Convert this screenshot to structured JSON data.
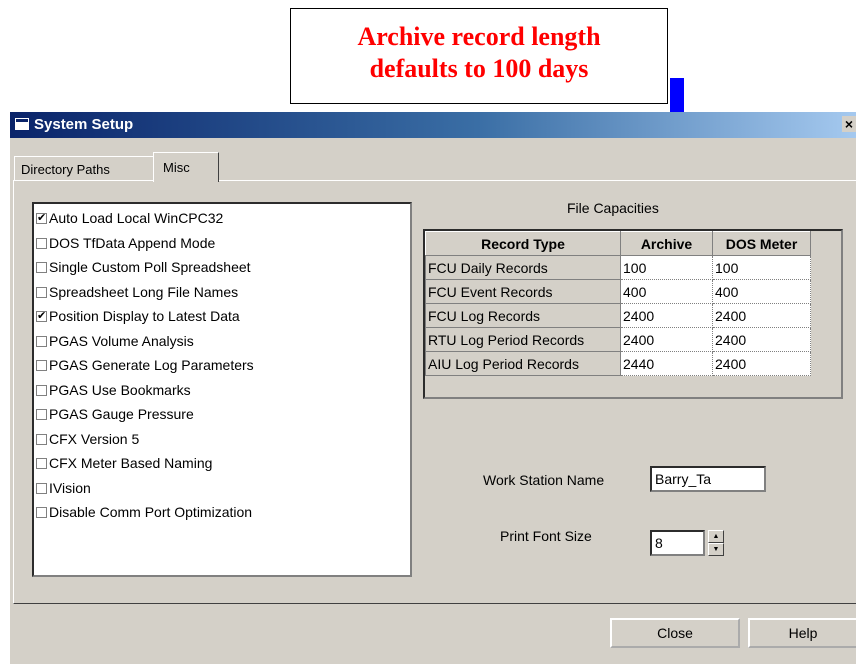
{
  "annotation": {
    "line1": "Archive record length",
    "line2": "defaults to 100 days",
    "text_color": "#ff0000",
    "arrow_color": "#0000ff"
  },
  "window": {
    "title": "System Setup",
    "close_glyph": "×",
    "titlebar_color": "#0a246a"
  },
  "tabs": [
    {
      "label": "Directory Paths",
      "active": false
    },
    {
      "label": "Misc",
      "active": true
    }
  ],
  "options": [
    {
      "label": "Auto Load Local WinCPC32",
      "checked": true
    },
    {
      "label": "DOS TfData Append Mode",
      "checked": false
    },
    {
      "label": "Single Custom Poll Spreadsheet",
      "checked": false
    },
    {
      "label": "Spreadsheet Long File Names",
      "checked": false
    },
    {
      "label": "Position Display to Latest Data",
      "checked": true
    },
    {
      "label": "PGAS Volume Analysis",
      "checked": false
    },
    {
      "label": "PGAS Generate Log Parameters",
      "checked": false
    },
    {
      "label": "PGAS Use Bookmarks",
      "checked": false
    },
    {
      "label": "PGAS Gauge Pressure",
      "checked": false
    },
    {
      "label": "CFX Version 5",
      "checked": false
    },
    {
      "label": "CFX Meter Based Naming",
      "checked": false
    },
    {
      "label": "IVision",
      "checked": false
    },
    {
      "label": "Disable Comm Port Optimization",
      "checked": false
    }
  ],
  "file_capacities": {
    "label": "File Capacities",
    "headers": [
      "Record Type",
      "Archive",
      "DOS Meter"
    ],
    "rows": [
      [
        "FCU Daily Records",
        "100",
        "100"
      ],
      [
        "FCU Event Records",
        "400",
        "400"
      ],
      [
        "FCU Log Records",
        "2400",
        "2400"
      ],
      [
        "RTU Log Period Records",
        "2400",
        "2400"
      ],
      [
        "AIU Log Period Records",
        "2440",
        "2400"
      ]
    ]
  },
  "workstation": {
    "label": "Work Station Name",
    "value": "Barry_Ta"
  },
  "print_font": {
    "label": "Print Font Size",
    "value": "8",
    "spin_up": "▲",
    "spin_down": "▼"
  },
  "buttons": {
    "close": "Close",
    "help": "Help"
  }
}
